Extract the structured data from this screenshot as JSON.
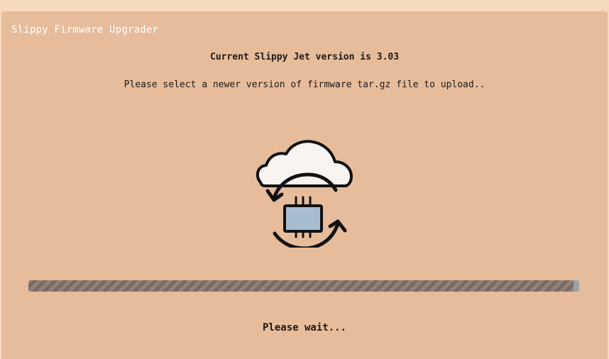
{
  "app": {
    "title": "Slippy Firmware Upgrader"
  },
  "main": {
    "version_text": "Current Slippy Jet version is 3.03",
    "instruction_text": "Please select a newer version of firmware tar.gz file to upload..",
    "icon_name": "cloud-chip-sync-icon",
    "progress": {
      "fraction": 0.99
    },
    "status_text": "Please wait..."
  },
  "colors": {
    "page_bg": "#f5d9bd",
    "panel_bg": "#e6bc9b",
    "progress_fill": "#7b6a62",
    "progress_track": "#9aa2a8",
    "chip_fill": "#a7bccf",
    "cloud_fill": "#f8f4f1"
  }
}
